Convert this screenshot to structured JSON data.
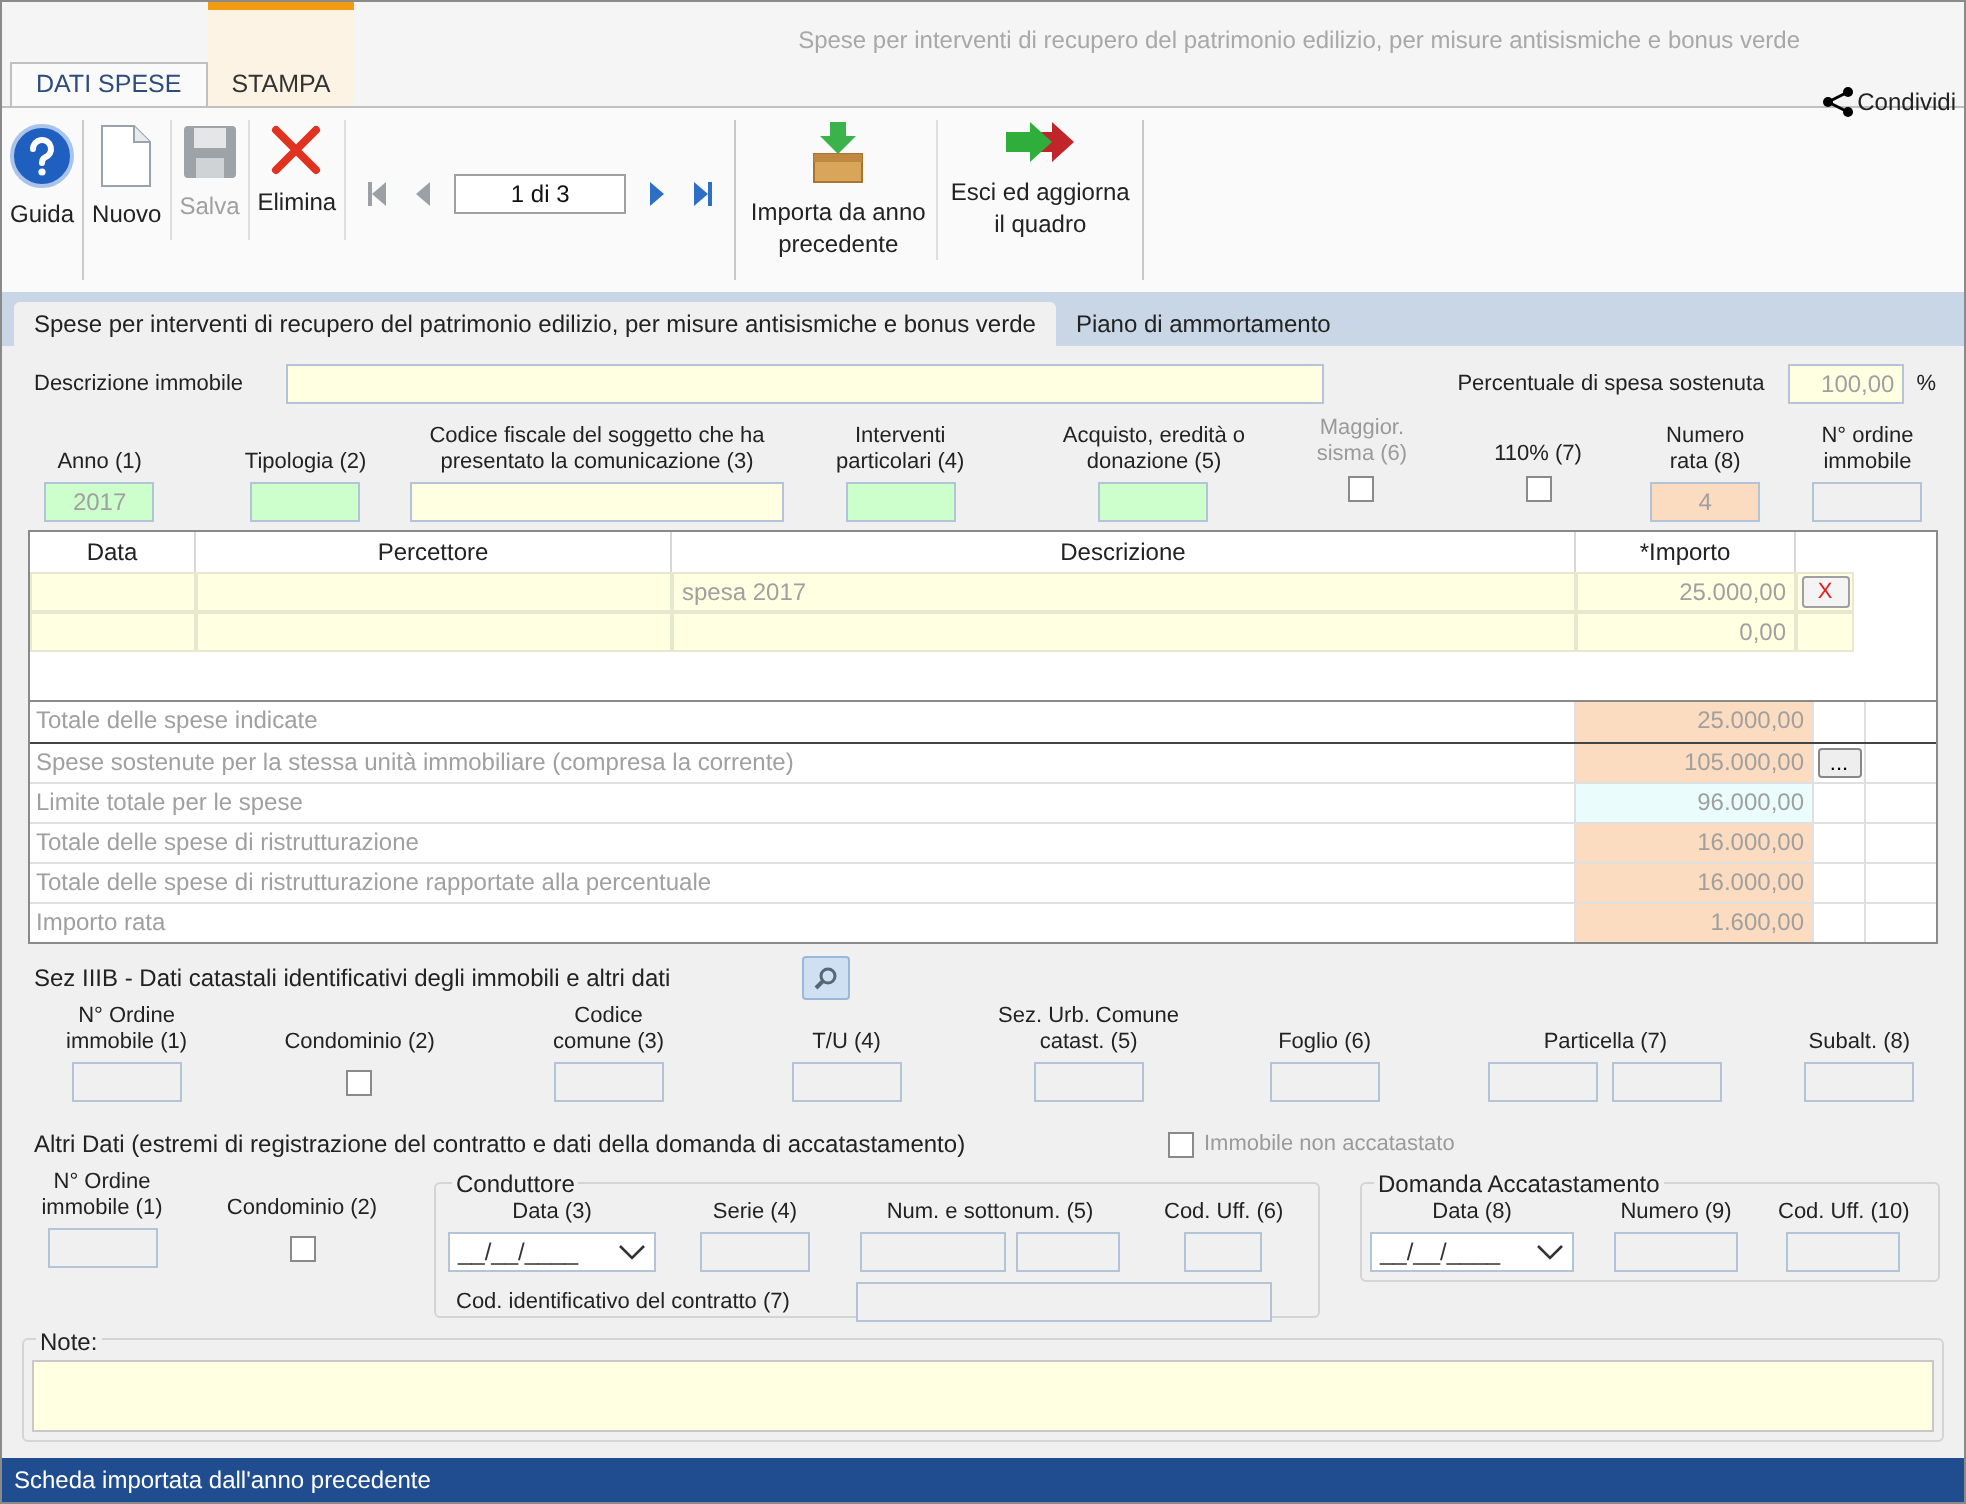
{
  "window": {
    "title": "Spese per interventi di recupero del patrimonio edilizio, per misure antisismiche e bonus verde"
  },
  "ribbon_tabs": [
    {
      "label": "DATI SPESE",
      "selected": true
    },
    {
      "label": "STAMPA",
      "selected": false
    }
  ],
  "share": {
    "label": "Condividi"
  },
  "toolbar": {
    "buttons": [
      {
        "kind": "help",
        "label": "Guida",
        "disabled": false
      },
      {
        "kind": "new",
        "label": "Nuovo",
        "disabled": false
      },
      {
        "kind": "save",
        "label": "Salva",
        "disabled": true
      },
      {
        "kind": "delete",
        "label": "Elimina",
        "disabled": false
      }
    ],
    "pager": {
      "value": "1 di 3"
    },
    "actions": [
      {
        "kind": "import",
        "label": "Importa da anno precedente"
      },
      {
        "kind": "exit",
        "label": "Esci ed aggiorna il quadro"
      }
    ]
  },
  "form_tabs": [
    {
      "label": "Spese per interventi di recupero del patrimonio edilizio, per misure antisismiche e bonus verde",
      "selected": true
    },
    {
      "label": "Piano di ammortamento",
      "selected": false
    }
  ],
  "descrizione": {
    "label": "Descrizione immobile"
  },
  "percentuale": {
    "label": "Percentuale di spesa sostenuta",
    "value": "100,00",
    "unit": "%"
  },
  "header_fields": [
    {
      "kind": "text",
      "label": "Anno (1)",
      "value": "2017",
      "color": "#ccffcc"
    },
    {
      "kind": "text",
      "label": "Tipologia (2)",
      "color": "#ccffcc"
    },
    {
      "kind": "text",
      "label": "Codice fiscale del soggetto che ha presentato la comunicazione (3)",
      "color": "#ffffe1"
    },
    {
      "kind": "text",
      "label": "Interventi particolari (4)",
      "color": "#ccffcc"
    },
    {
      "kind": "text",
      "label": "Acquisto, eredità o donazione (5)",
      "color": "#ccffcc"
    },
    {
      "kind": "checkbox",
      "label": "Maggior. sisma (6)",
      "checked": false,
      "disabled": true
    },
    {
      "kind": "checkbox",
      "label": "110% (7)",
      "checked": false
    },
    {
      "kind": "text",
      "label": "Numero rata (8)",
      "value": "4",
      "color": "#fcdcc0"
    },
    {
      "kind": "text",
      "label": "N° ordine immobile",
      "color": "#f0f0f0"
    }
  ],
  "expense_table": {
    "columns": [
      "Data",
      "Percettore",
      "Descrizione",
      "*Importo"
    ],
    "rows": [
      {
        "descrizione": "spesa 2017",
        "importo": "25.000,00",
        "delete": "X"
      },
      {
        "importo": "0,00"
      }
    ]
  },
  "totals": [
    {
      "label": "Totale delle spese indicate",
      "value": "25.000,00",
      "color": "#fcdcc0"
    },
    {
      "label": "Spese sostenute per la stessa unità immobiliare (compresa la corrente)",
      "value": "105.000,00",
      "color": "#fcdcc0",
      "button": "..."
    },
    {
      "label": "Limite totale per le spese",
      "value": "96.000,00",
      "color": "#eafcfc"
    },
    {
      "label": "Totale delle spese di ristrutturazione",
      "value": "16.000,00",
      "color": "#fcdcc0"
    },
    {
      "label": "Totale delle spese di ristrutturazione rapportate alla percentuale",
      "value": "16.000,00",
      "color": "#fcdcc0"
    },
    {
      "label": "Importo rata",
      "value": "1.600,00",
      "color": "#fcdcc0"
    }
  ],
  "sez_iiib": {
    "title": "Sez IIIB - Dati catastali identificativi degli immobili e altri dati",
    "fields": [
      {
        "kind": "text",
        "label": "N° Ordine immobile (1)"
      },
      {
        "kind": "checkbox",
        "label": "Condominio (2)",
        "checked": false
      },
      {
        "kind": "text",
        "label": "Codice comune (3)"
      },
      {
        "kind": "text",
        "label": "T/U (4)"
      },
      {
        "kind": "text",
        "label": "Sez. Urb. Comune catast. (5)"
      },
      {
        "kind": "text",
        "label": "Foglio (6)"
      },
      {
        "kind": "pair",
        "label": "Particella (7)"
      },
      {
        "kind": "text",
        "label": "Subalt. (8)"
      }
    ]
  },
  "altri_dati": {
    "title": "Altri Dati (estremi di registrazione del contratto e dati della domanda di accatastamento)",
    "non_accatastato": {
      "label": "Immobile non accatastato",
      "checked": false,
      "disabled": true
    },
    "fields": [
      {
        "kind": "text",
        "label": "N° Ordine immobile (1)"
      },
      {
        "kind": "checkbox",
        "label": "Condominio (2)",
        "checked": false
      }
    ],
    "conduttore": {
      "title": "Conduttore",
      "data": {
        "label": "Data (3)",
        "value": "__/__/____"
      },
      "serie": {
        "label": "Serie (4)"
      },
      "num": {
        "label": "Num. e sottonum. (5)"
      },
      "cod_uff": {
        "label": "Cod. Uff. (6)"
      },
      "cod_contratto": {
        "label": "Cod. identificativo del contratto (7)"
      }
    },
    "domanda": {
      "title": "Domanda Accatastamento",
      "data": {
        "label": "Data (8)",
        "value": "__/__/____"
      },
      "numero": {
        "label": "Numero (9)"
      },
      "cod_uff": {
        "label": "Cod. Uff. (10)"
      }
    }
  },
  "note": {
    "label": "Note:"
  },
  "status_bar": {
    "text": "Scheda importata dall'anno precedente"
  }
}
